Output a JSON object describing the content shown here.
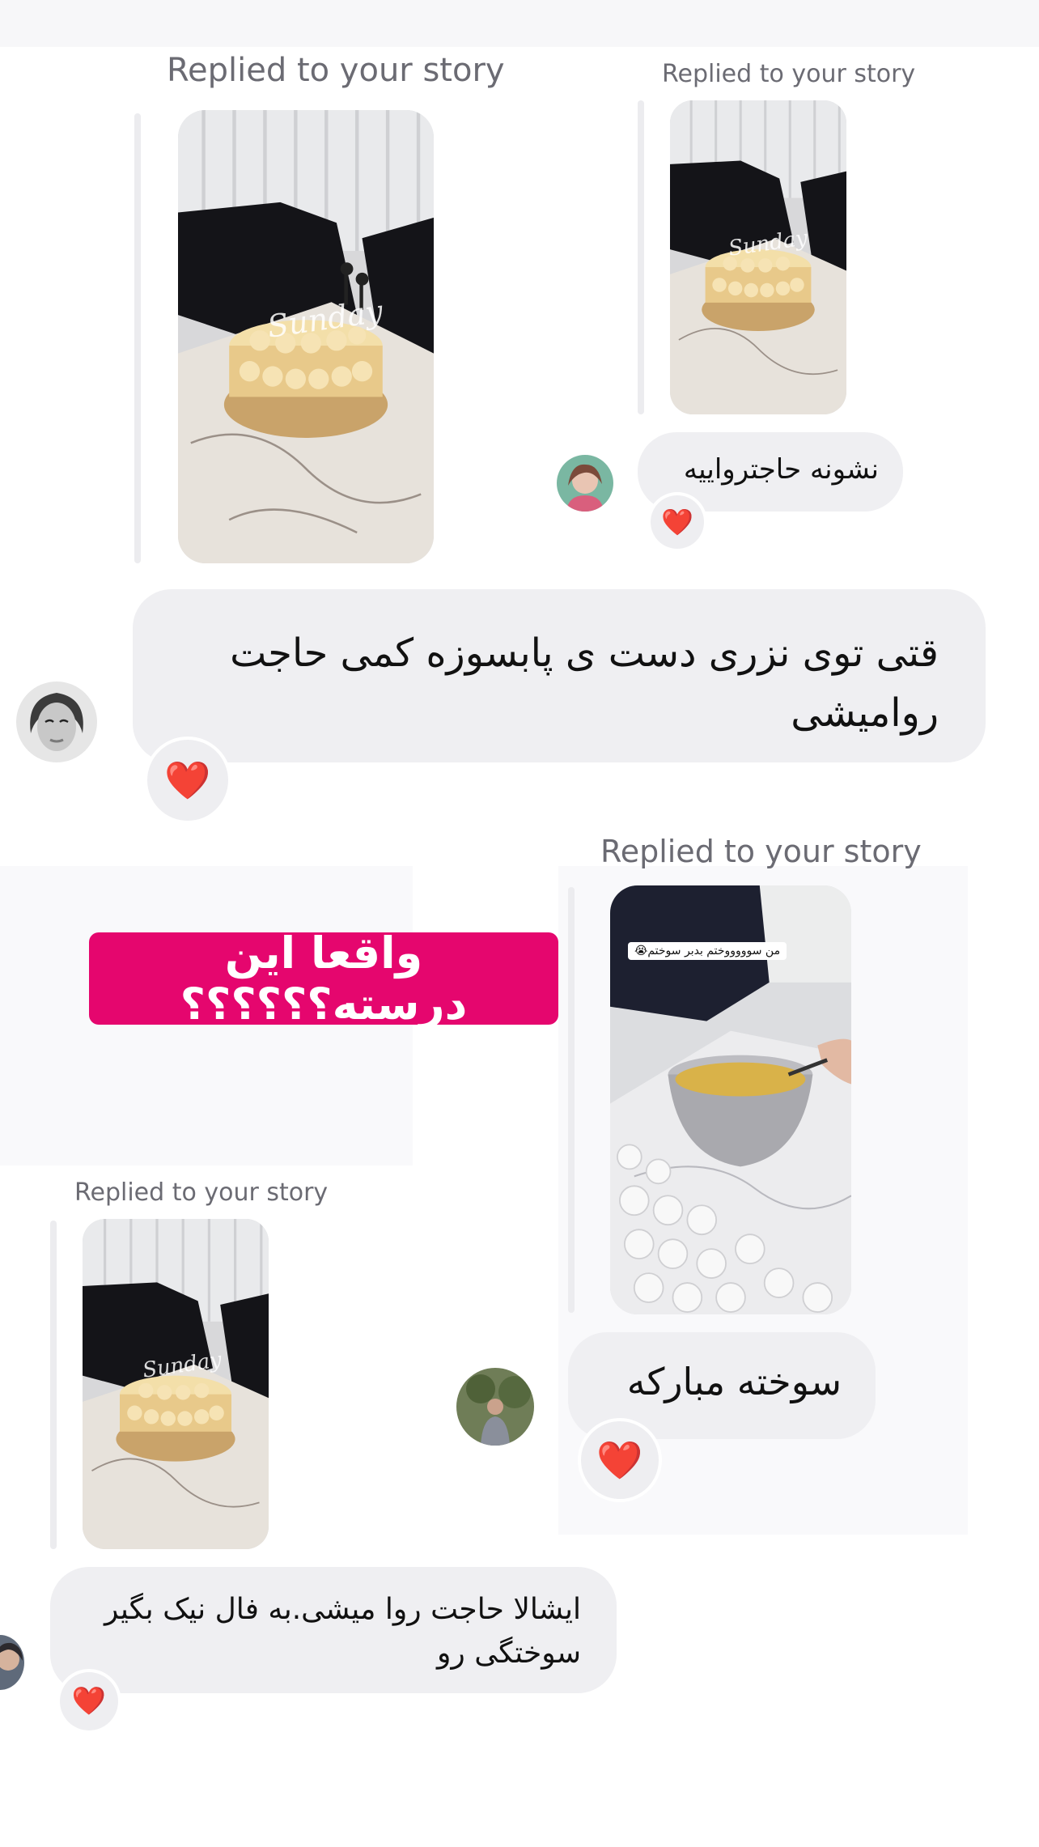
{
  "replies": [
    {
      "label": "Replied to your story"
    },
    {
      "label": "Replied to your story"
    },
    {
      "label": "Replied to your story"
    },
    {
      "label": "Replied to your story"
    }
  ],
  "stories": [
    {
      "overlay": "Sunday"
    },
    {
      "overlay": "Sunday"
    },
    {
      "caption": "من سوووووختم بدبر سوختم😭"
    },
    {
      "overlay": "Sunday"
    }
  ],
  "messages": [
    {
      "text": "نشونه حاجتروایيه",
      "reaction": "❤️"
    },
    {
      "text": "قتی توی نزری دست ی پابسوزه کمی حاجت روامیشی",
      "reaction": "❤️"
    },
    {
      "text": "سوخته  مبارکه",
      "reaction": "❤️"
    },
    {
      "text": "ایشالا حاجت روا میشی.به فال نیک بگیر سوختگی رو",
      "reaction": "❤️"
    }
  ],
  "sticker": {
    "text": "واقعا این درسته؟؟؟؟؟؟"
  },
  "colors": {
    "bubble": "#efeff2",
    "sticker": "#e5066e",
    "label": "#6b6b73",
    "heart": "#e8202a"
  }
}
